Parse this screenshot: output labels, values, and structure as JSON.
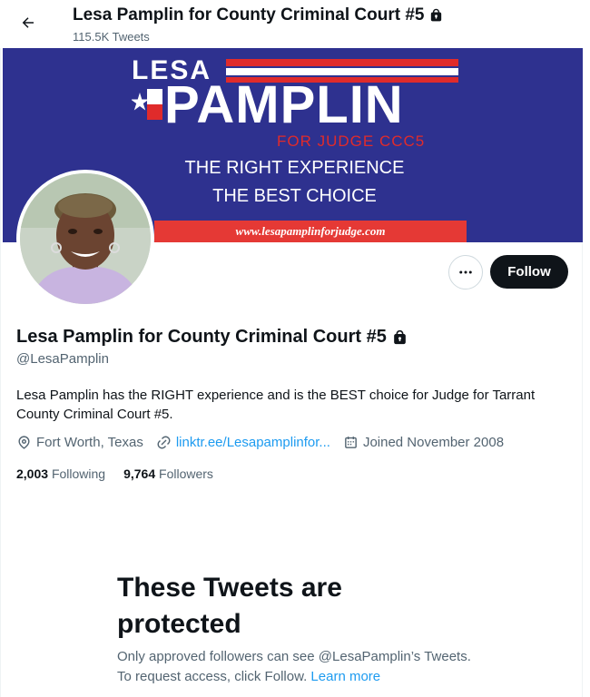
{
  "header": {
    "title": "Lesa Pamplin for County Criminal Court #5",
    "tweet_count": "115.5K Tweets"
  },
  "banner": {
    "word1": "LESA",
    "word2": "PAMPLIN",
    "subtitle": "FOR JUDGE CCC5",
    "line1": "THE RIGHT EXPERIENCE",
    "line2": "THE BEST CHOICE",
    "url": "www.lesapamplinforjudge.com"
  },
  "actions": {
    "more_label": "•••",
    "follow_label": "Follow"
  },
  "profile": {
    "name": "Lesa Pamplin for County Criminal Court #5",
    "handle": "@LesaPamplin",
    "bio": "Lesa Pamplin has the RIGHT experience and is the BEST choice for Judge for Tarrant County Criminal Court #5.",
    "location": "Fort Worth, Texas",
    "link": "linktr.ee/Lesapamplinfor...",
    "joined": "Joined November 2008"
  },
  "stats": {
    "following_count": "2,003",
    "following_label": "Following",
    "followers_count": "9,764",
    "followers_label": "Followers"
  },
  "protected": {
    "title": "These Tweets are protected",
    "text": "Only approved followers can see @LesaPamplin’s Tweets. To request access, click Follow.",
    "link": "Learn more"
  },
  "colors": {
    "accent": "#1d9bf0",
    "banner_blue": "#2e318f",
    "banner_red": "#e53935",
    "button_dark": "#0f1419",
    "secondary_text": "#536471"
  },
  "icons": {
    "back": "arrow-left-icon",
    "lock": "lock-icon",
    "location": "location-pin-icon",
    "link": "link-icon",
    "calendar": "calendar-icon",
    "more": "more-dots-icon"
  }
}
